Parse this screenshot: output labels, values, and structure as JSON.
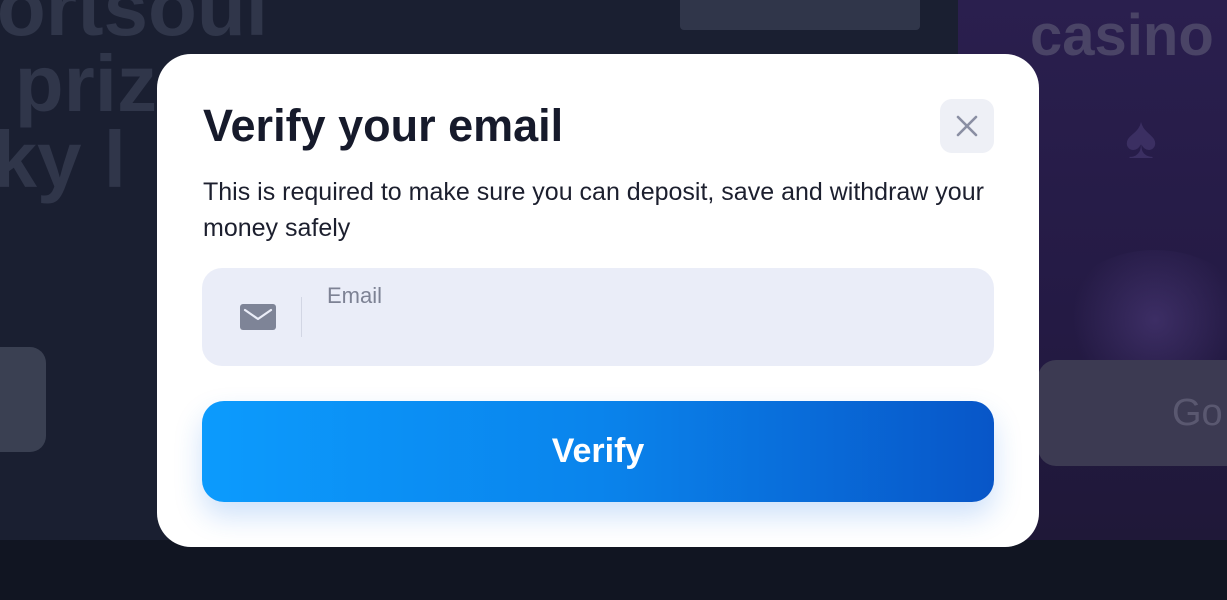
{
  "background": {
    "heading_lines": [
      "portsoul",
      "e priz",
      "cky l"
    ],
    "right_heading": "casino",
    "go_button_label": "Go"
  },
  "modal": {
    "title": "Verify your email",
    "description": "This is required to make sure you can deposit, save and withdraw your money safely",
    "close_icon": "close-icon",
    "email_field": {
      "icon": "mail-icon",
      "label": "Email",
      "value": ""
    },
    "verify_button_label": "Verify"
  },
  "colors": {
    "modal_background": "#ffffff",
    "field_background": "#eaedf8",
    "button_gradient_start": "#0c9bfd",
    "button_gradient_end": "#0856c8",
    "title_text": "#161a2b",
    "overlay_background": "#131726"
  }
}
